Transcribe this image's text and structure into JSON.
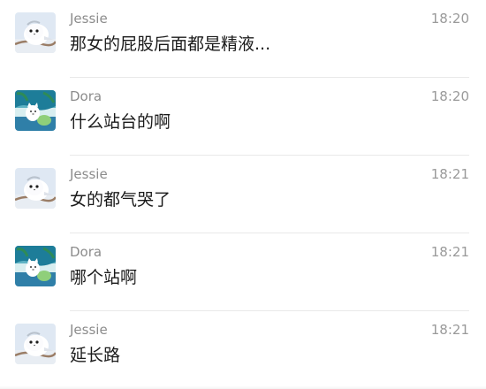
{
  "colors": {
    "sender": "#8c8c8c",
    "time": "#9a9a9a",
    "message": "#1a1a1a",
    "divider": "#e9e9e9"
  },
  "chats": [
    {
      "sender": "Jessie",
      "time": "18:20",
      "message": "那女的屁股后面都是精液...",
      "avatar": "bird-avatar"
    },
    {
      "sender": "Dora",
      "time": "18:20",
      "message": "什么站台的啊",
      "avatar": "cat-beach-avatar"
    },
    {
      "sender": "Jessie",
      "time": "18:21",
      "message": "女的都气哭了",
      "avatar": "bird-avatar"
    },
    {
      "sender": "Dora",
      "time": "18:21",
      "message": "哪个站啊",
      "avatar": "cat-beach-avatar"
    },
    {
      "sender": "Jessie",
      "time": "18:21",
      "message": "延长路",
      "avatar": "bird-avatar"
    }
  ]
}
